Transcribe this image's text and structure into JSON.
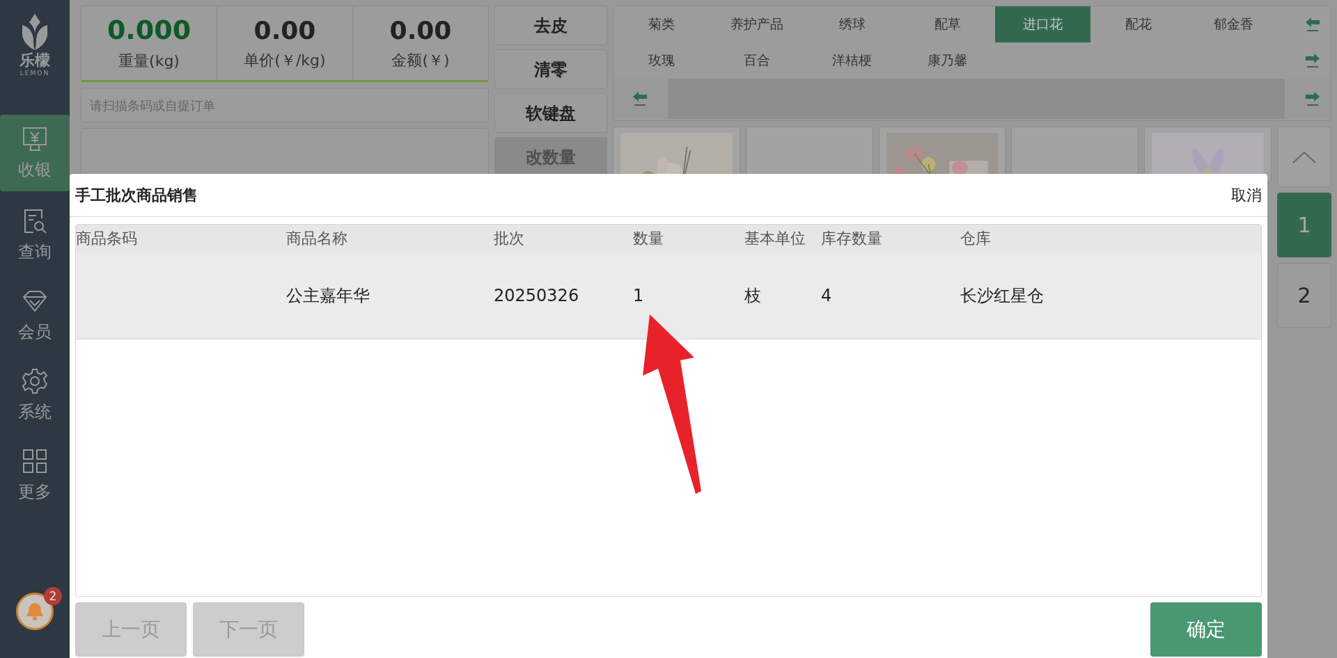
{
  "sidebar": {
    "logo_text": "乐檬",
    "logo_subtext": "LEMON",
    "items": [
      {
        "label": "收银",
        "selected": true
      },
      {
        "label": "查询",
        "selected": false
      },
      {
        "label": "会员",
        "selected": false
      },
      {
        "label": "系统",
        "selected": false
      },
      {
        "label": "更多",
        "selected": false
      }
    ],
    "notification_count": "2"
  },
  "scale": [
    {
      "kind": "primary",
      "value": "0.000",
      "label": "重量(kg)"
    },
    {
      "kind": "plain",
      "value": "0.00",
      "label": "单价(￥/kg)"
    },
    {
      "kind": "plain",
      "value": "0.00",
      "label": "金额(￥)"
    }
  ],
  "search": {
    "placeholder": "请扫描条码或自提订单"
  },
  "actions": [
    {
      "label": "去皮",
      "disabled": false
    },
    {
      "label": "清零",
      "disabled": false
    },
    {
      "label": "软键盘",
      "disabled": false
    },
    {
      "label": "改数量",
      "disabled": true
    }
  ],
  "categories": [
    [
      {
        "label": "菊类",
        "selected": false
      },
      {
        "label": "养护产品",
        "selected": false
      },
      {
        "label": "绣球",
        "selected": false
      },
      {
        "label": "配草",
        "selected": false
      },
      {
        "label": "进口花",
        "selected": true
      },
      {
        "label": "配花",
        "selected": false
      },
      {
        "label": "郁金香",
        "selected": false
      }
    ],
    [
      {
        "label": "玫瑰",
        "selected": false
      },
      {
        "label": "百合",
        "selected": false
      },
      {
        "label": "洋桔梗",
        "selected": false
      },
      {
        "label": "康乃馨",
        "selected": false
      }
    ]
  ],
  "products": [
    {
      "kind": "picture"
    },
    {
      "kind": "blank"
    },
    {
      "kind": "picture"
    },
    {
      "kind": "blank"
    },
    {
      "kind": "picture"
    }
  ],
  "pages": [
    {
      "label": "1",
      "selected": true
    },
    {
      "label": "2",
      "selected": false
    }
  ],
  "dialog": {
    "title": "手工批次商品销售",
    "cancel": "取消",
    "columns": [
      "商品条码",
      "商品名称",
      "批次",
      "数量",
      "基本单位",
      "库存数量",
      "仓库"
    ],
    "rows": [
      {
        "name": "公主嘉年华",
        "batch": "20250326",
        "qty": "1",
        "unit": "枝",
        "stock": "4",
        "warehouse": "长沙红星仓"
      }
    ],
    "prev": {
      "label": "上一页",
      "disabled": true
    },
    "next": {
      "label": "下一页",
      "disabled": true
    },
    "confirm": "确定"
  }
}
